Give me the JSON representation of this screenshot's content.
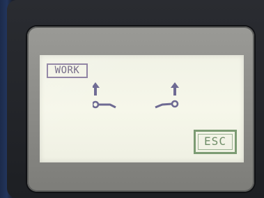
{
  "screen": {
    "mode_label": "WORK",
    "esc_label": "ESC"
  },
  "icons": {
    "left": "switch-up-left-icon",
    "right": "switch-up-right-icon"
  },
  "colors": {
    "screen_bg": "#f3f4e8",
    "mode_badge": "#8c7fa0",
    "icon_color": "#6e6a93",
    "esc_border": "#7c9b73"
  }
}
